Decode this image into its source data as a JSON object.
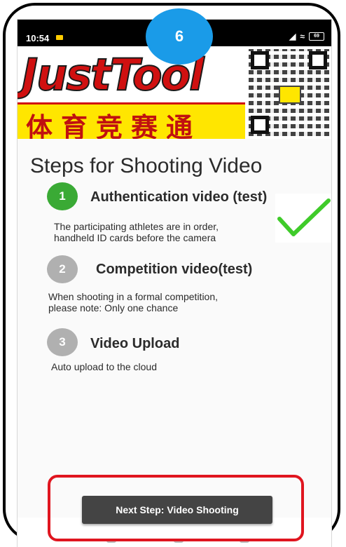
{
  "status_bar": {
    "time": "10:54",
    "right_icons": [
      "signal-icon",
      "wifi-icon",
      "battery-icon"
    ],
    "battery_text": "69"
  },
  "banner": {
    "brand_logo_text": "JustTool",
    "brand_cn": "体育竞赛通"
  },
  "step_badge": "6",
  "page_title": "Steps for Shooting Video",
  "steps": [
    {
      "number": "1",
      "title": "Authentication video (test)",
      "desc_line1": "The participating athletes are in order,",
      "desc_line2": "handheld ID cards before the camera",
      "color": "#3aaa35",
      "completed": true
    },
    {
      "number": "2",
      "title": "Competition video(test)",
      "desc_line1": "When shooting in a formal competition,",
      "desc_line2": "please note: Only one chance",
      "color": "#b0b0b0",
      "completed": false
    },
    {
      "number": "3",
      "title": "Video Upload",
      "desc_line1": "Auto upload to the cloud",
      "color": "#b0b0b0",
      "completed": false
    }
  ],
  "next_button_label": "Next Step: Video Shooting",
  "colors": {
    "badge": "#1a9be8",
    "highlight_box": "#e0151f",
    "check": "#3fcb2a",
    "button": "#444444"
  }
}
